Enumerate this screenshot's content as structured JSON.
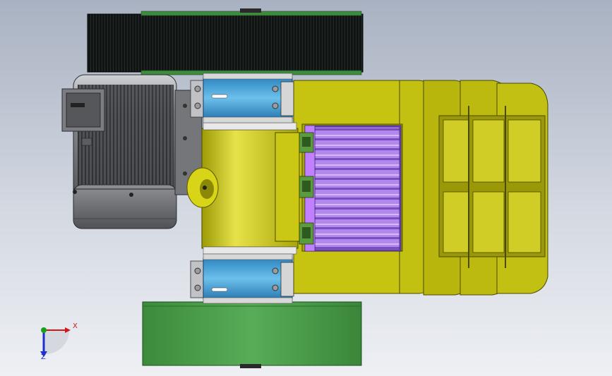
{
  "triad": {
    "x_label": "X",
    "z_label": "Z",
    "x_color": "#d01818",
    "y_color": "#16a316",
    "z_color": "#1f2fd0"
  },
  "colors": {
    "belt_dark": "#101412",
    "belt_green": "#4da04d",
    "motor_gray": "#7d7f83",
    "housing_yellow": "#c6c410",
    "bearing_blue": "#4aa4d8",
    "roller_purple": "#a878e8",
    "gusset_green": "#4e8a38"
  }
}
